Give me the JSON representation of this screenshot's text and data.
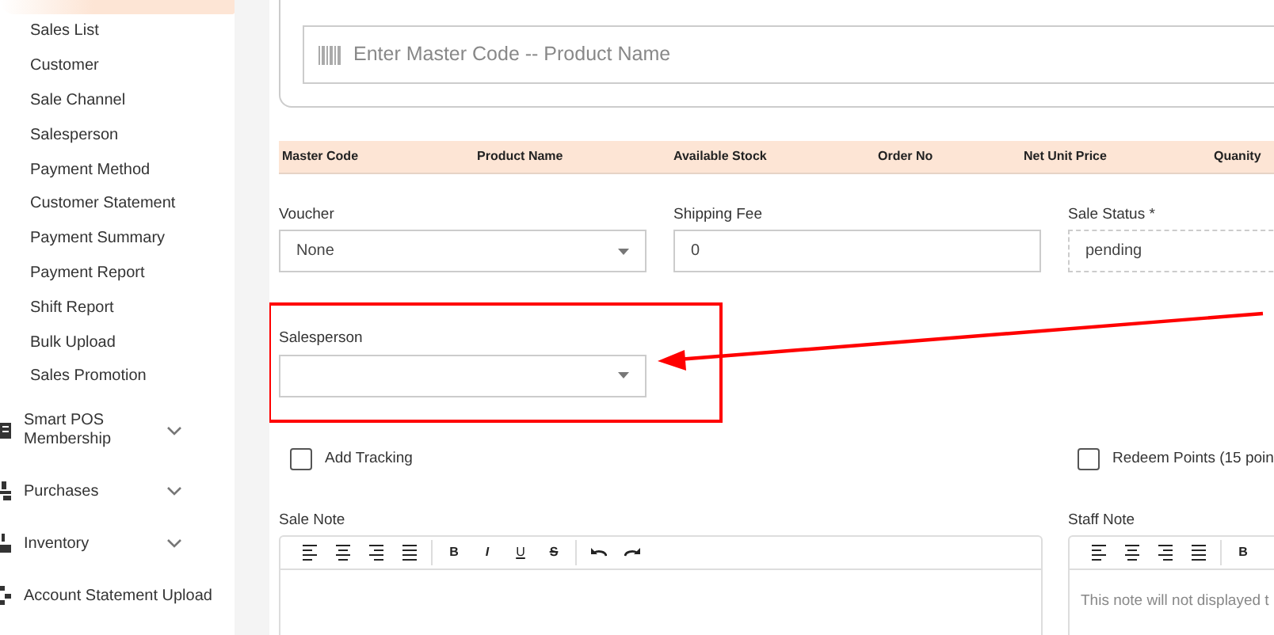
{
  "sidebar": {
    "items": [
      {
        "label": "Sales List"
      },
      {
        "label": "Customer"
      },
      {
        "label": "Sale Channel"
      },
      {
        "label": "Salesperson"
      },
      {
        "label": "Payment Method"
      },
      {
        "label": "Customer Statement"
      },
      {
        "label": "Payment Summary"
      },
      {
        "label": "Payment Report"
      },
      {
        "label": "Shift Report"
      },
      {
        "label": "Bulk Upload"
      },
      {
        "label": "Sales Promotion"
      }
    ],
    "sections": [
      {
        "label": "Smart POS Membership",
        "expandable": true
      },
      {
        "label": "Purchases",
        "expandable": true
      },
      {
        "label": "Inventory",
        "expandable": true
      },
      {
        "label": "Account Statement Upload",
        "expandable": false
      }
    ]
  },
  "product_search": {
    "placeholder": "Enter Master Code -- Product Name"
  },
  "table": {
    "columns": [
      "Master Code",
      "Product Name",
      "Available Stock",
      "Order No",
      "Net Unit Price",
      "Quanity"
    ]
  },
  "fields": [
    {
      "label": "Voucher",
      "kind": "select",
      "value": "None"
    },
    {
      "label": "Shipping Fee",
      "kind": "input",
      "value": "0"
    },
    {
      "label": "Sale Status *",
      "kind": "readonly",
      "value": "pending"
    }
  ],
  "salesperson": {
    "label": "Salesperson",
    "highlighted": true
  },
  "checkboxes": [
    {
      "label": "Add Tracking",
      "checked": false
    },
    {
      "label": "Redeem Points (15 poin",
      "checked": false
    }
  ],
  "notes": [
    {
      "label": "Sale Note",
      "toolbar": [
        {
          "kind": "align-left"
        },
        {
          "kind": "align-center"
        },
        {
          "kind": "align-right"
        },
        {
          "kind": "align-justify"
        },
        {
          "kind": "separator"
        },
        {
          "kind": "bold",
          "label": "B"
        },
        {
          "kind": "italic",
          "label": "I"
        },
        {
          "kind": "underline",
          "label": "U"
        },
        {
          "kind": "strike",
          "label": "S"
        },
        {
          "kind": "separator"
        },
        {
          "kind": "undo"
        },
        {
          "kind": "redo"
        }
      ]
    },
    {
      "label": "Staff Note",
      "placeholder": "This note will not displayed t",
      "toolbar": [
        {
          "kind": "align-left"
        },
        {
          "kind": "align-center"
        },
        {
          "kind": "align-right"
        },
        {
          "kind": "align-justify"
        },
        {
          "kind": "separator"
        },
        {
          "kind": "bold",
          "label": "B"
        }
      ]
    }
  ]
}
